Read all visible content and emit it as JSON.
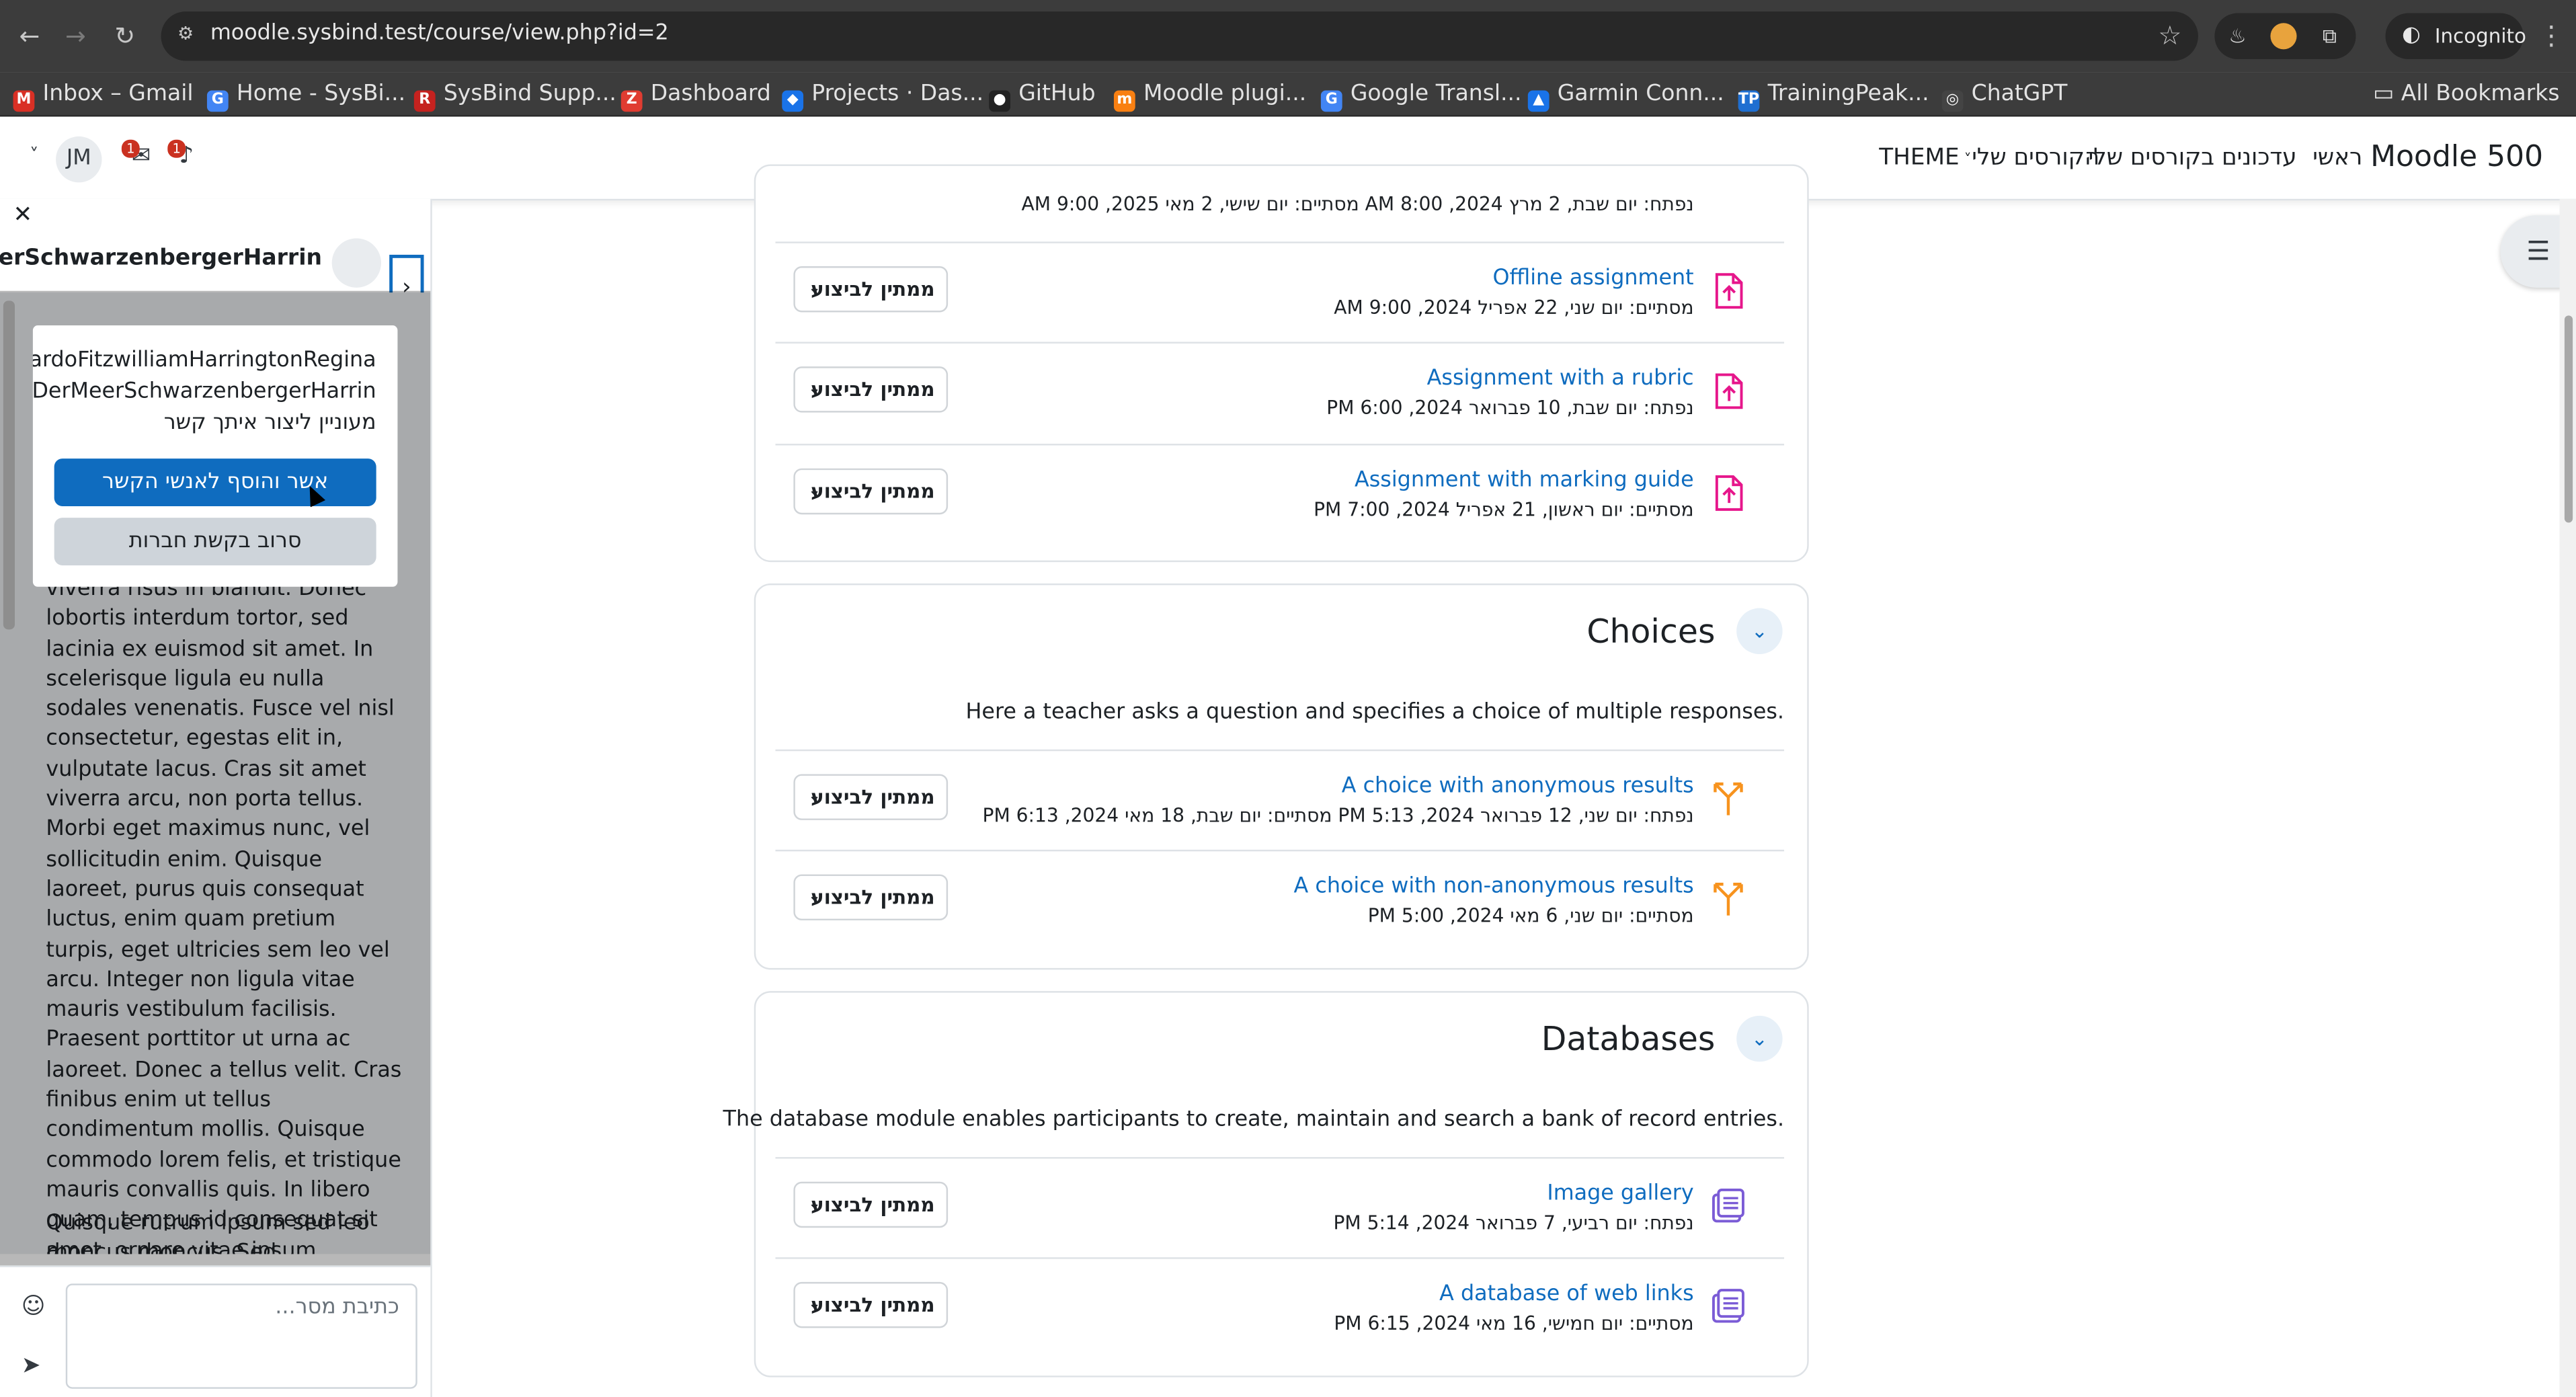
{
  "browser": {
    "url": "moodle.sysbind.test/course/view.php?id=2",
    "incognito_label": "Incognito",
    "all_bookmarks_label": "All Bookmarks",
    "bookmarks": [
      {
        "label": "Inbox – Gmail",
        "icon": "gmail-icon",
        "color": "#d93025",
        "glyph": "M"
      },
      {
        "label": "Home - SysBi...",
        "icon": "google-icon",
        "color": "#4285f4",
        "glyph": "G"
      },
      {
        "label": "SysBind Supp...",
        "icon": "r-icon",
        "color": "#c5221f",
        "glyph": "R"
      },
      {
        "label": "Dashboard",
        "icon": "z-icon",
        "color": "#e03c31",
        "glyph": "Z"
      },
      {
        "label": "Projects · Das...",
        "icon": "shield-icon",
        "color": "#1a73e8",
        "glyph": "◆"
      },
      {
        "label": "GitHub",
        "icon": "github-icon",
        "color": "#222222",
        "glyph": "●"
      },
      {
        "label": "Moodle plugi...",
        "icon": "moodle-icon",
        "color": "#f98012",
        "glyph": "m"
      },
      {
        "label": "Google Transl...",
        "icon": "translate-icon",
        "color": "#4285f4",
        "glyph": "G"
      },
      {
        "label": "Garmin Conn...",
        "icon": "garmin-icon",
        "color": "#1a73e8",
        "glyph": "▲"
      },
      {
        "label": "TrainingPeak...",
        "icon": "trainingpeaks-icon",
        "color": "#1f6fd1",
        "glyph": "TP"
      },
      {
        "label": "ChatGPT",
        "icon": "chatgpt-icon",
        "color": "#444444",
        "glyph": "◎"
      }
    ]
  },
  "moodle_nav": {
    "brand": "Moodle 500",
    "links": [
      "ראשי",
      "עדכונים בקורסים שלי",
      "הקורסים שלי",
      "THEME"
    ],
    "user_initials": "JM",
    "messages_count": "1",
    "notifications_count": "1"
  },
  "drawer": {
    "contact_name": "...MeerSchwarzenbergerHarrin",
    "message_text": "viverra risus in blandit. Donec lobortis interdum tortor, sed lacinia ex euismod sit amet. In scelerisque ligula eu nulla sodales venenatis. Fusce vel nisl consectetur, egestas elit in, vulputate lacus. Cras sit amet viverra arcu, non porta tellus. Morbi eget maximus nunc, vel sollicitudin enim. Quisque laoreet, purus quis consequat luctus, enim quam pretium turpis, eget ultricies sem leo vel arcu. Integer non ligula vitae mauris vestibulum facilisis. Praesent porttitor ut urna ac laoreet. Donec a tellus velit. Cras finibus enim ut tellus condimentum mollis. Quisque commodo lorem felis, et tristique mauris convallis quis. In libero quam, tempus id consequat sit amet, ornare vitae ipsum.",
    "message_text_2": "Quisque rutrum ipsum sed leo rhoncus rhoncus. Sed consectetur",
    "dialog": {
      "line1": "elLeonardoFitzwilliamHarringtonRegina",
      "line2": "aldVanDerMeerSchwarzenbergerHarrin",
      "line3": "מעוניין ליצור איתך קשר",
      "accept_label": "אשר והוסף לאנשי הקשר",
      "decline_label": "סרוב בקשת חברות"
    },
    "composer_placeholder": "כתיבת מסר..."
  },
  "course": {
    "status_label": "ממתין לביצוע",
    "top_partial": {
      "date": "נפתח: יום שבת, 2 מרץ 2024, 8:00 AM   מסתיים: יום שישי, 2 מאי 2025, 9:00 AM"
    },
    "assignments": [
      {
        "name": "Offline assignment",
        "date": "מסתיים: יום שני, 22 אפריל 2024, 9:00 AM",
        "icon": "assignment-upload-icon"
      },
      {
        "name": "Assignment with a rubric",
        "date": "נפתח: יום שבת, 10 פברואר 2024, 6:00 PM",
        "icon": "assignment-upload-icon"
      },
      {
        "name": "Assignment with marking guide",
        "date": "מסתיים: יום ראשון, 21 אפריל 2024, 7:00 PM",
        "icon": "assignment-upload-icon"
      }
    ],
    "choices": {
      "title": "Choices",
      "description": "Here a teacher asks a question and specifies a choice of multiple responses.",
      "items": [
        {
          "name": "A choice with anonymous results",
          "date": "נפתח: יום שני, 12 פברואר 2024, 5:13 PM   מסתיים: יום שבת, 18 מאי 2024, 6:13 PM",
          "icon": "choice-icon"
        },
        {
          "name": "A choice with non-anonymous results",
          "date": "מסתיים: יום שני, 6 מאי 2024, 5:00 PM",
          "icon": "choice-icon"
        }
      ]
    },
    "databases": {
      "title": "Databases",
      "description": "The database module enables participants to create, maintain and search a bank of record entries.",
      "items": [
        {
          "name": "Image gallery",
          "date": "נפתח: יום רביעי, 7 פברואר 2024, 5:14 PM",
          "icon": "database-icon"
        },
        {
          "name": "A database of web links",
          "date": "מסתיים: יום חמישי, 16 מאי 2024, 6:15 PM",
          "icon": "database-icon"
        }
      ]
    }
  },
  "colors": {
    "brand_blue": "#0f6cbf",
    "assignment_pink": "#e6168b",
    "choice_orange": "#f7931e",
    "database_purple": "#7b5cd6"
  }
}
